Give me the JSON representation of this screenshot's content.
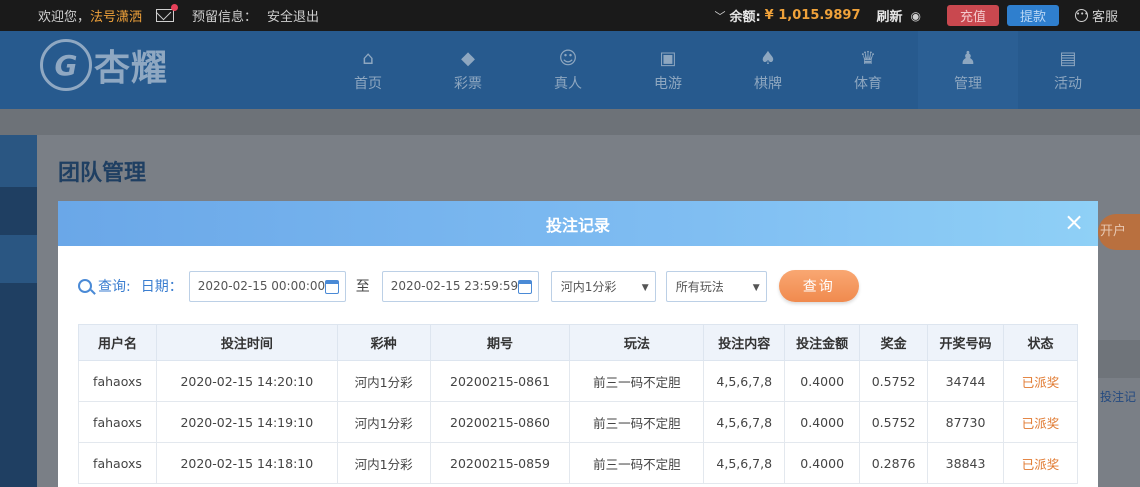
{
  "topbar": {
    "welcome": "欢迎您，",
    "username": "法号潇洒",
    "reserve_info": "预留信息：",
    "logout": "安全退出",
    "balance_label": "余额:",
    "balance": "¥ 1,015.9897",
    "refresh": "刷新",
    "charge": "充值",
    "withdraw": "提款",
    "service": "客服"
  },
  "header": {
    "logo_text": "杏耀",
    "nav": [
      {
        "label": "首页",
        "icon": "home-icon",
        "glyph": "⌂"
      },
      {
        "label": "彩票",
        "icon": "ticket-icon",
        "glyph": "◆"
      },
      {
        "label": "真人",
        "icon": "dealer-icon",
        "glyph": "☺"
      },
      {
        "label": "电游",
        "icon": "slot-machine-icon",
        "glyph": "▣"
      },
      {
        "label": "棋牌",
        "icon": "cards-icon",
        "glyph": "♠"
      },
      {
        "label": "体育",
        "icon": "trophy-icon",
        "glyph": "♛"
      },
      {
        "label": "管理",
        "icon": "users-icon",
        "glyph": "♟"
      },
      {
        "label": "活动",
        "icon": "gift-icon",
        "glyph": "▤"
      }
    ]
  },
  "page": {
    "title": "团队管理",
    "peek_button": "开户",
    "peek_link": "投注记"
  },
  "modal": {
    "title": "投注记录",
    "close": "×",
    "query_label": "查询:",
    "date_label": "日期：",
    "date_from": "2020-02-15 00:00:00",
    "to": "至",
    "date_to": "2020-02-15 23:59:59",
    "lottery_select": "河内1分彩",
    "play_select": "所有玩法",
    "query_button": "查询"
  },
  "table": {
    "headers": [
      "用户名",
      "投注时间",
      "彩种",
      "期号",
      "玩法",
      "投注内容",
      "投注金额",
      "奖金",
      "开奖号码",
      "状态"
    ],
    "rows": [
      [
        "fahaoxs",
        "2020-02-15 14:20:10",
        "河内1分彩",
        "20200215-0861",
        "前三一码不定胆",
        "4,5,6,7,8",
        "0.4000",
        "0.5752",
        "34744",
        "已派奖"
      ],
      [
        "fahaoxs",
        "2020-02-15 14:19:10",
        "河内1分彩",
        "20200215-0860",
        "前三一码不定胆",
        "4,5,6,7,8",
        "0.4000",
        "0.5752",
        "87730",
        "已派奖"
      ],
      [
        "fahaoxs",
        "2020-02-15 14:18:10",
        "河内1分彩",
        "20200215-0859",
        "前三一码不定胆",
        "4,5,6,7,8",
        "0.4000",
        "0.2876",
        "38843",
        "已派奖"
      ]
    ]
  }
}
